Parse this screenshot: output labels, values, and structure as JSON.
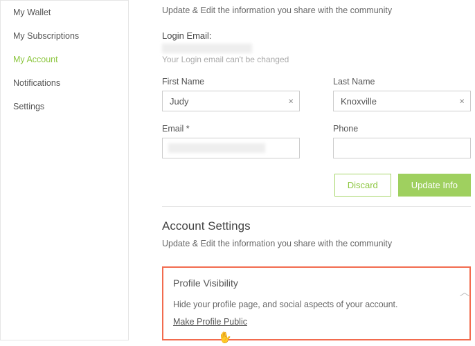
{
  "sidebar": {
    "items": [
      {
        "label": "My Wallet"
      },
      {
        "label": "My Subscriptions"
      },
      {
        "label": "My Account"
      },
      {
        "label": "Notifications"
      },
      {
        "label": "Settings"
      }
    ]
  },
  "main": {
    "intro_subtitle": "Update & Edit the information you share with the community",
    "login_email_label": "Login Email:",
    "login_email_hint": "Your Login email can't be changed",
    "first_name_label": "First Name",
    "first_name_value": "Judy",
    "last_name_label": "Last Name",
    "last_name_value": "Knoxville",
    "email_label": "Email *",
    "phone_label": "Phone",
    "discard_label": "Discard",
    "update_label": "Update Info",
    "account_settings_title": "Account Settings",
    "account_settings_subtitle": "Update & Edit the information you share with the community",
    "profile_visibility_title": "Profile Visibility",
    "profile_visibility_desc": "Hide your profile page, and social aspects of your account.",
    "profile_visibility_link": "Make Profile Public"
  }
}
